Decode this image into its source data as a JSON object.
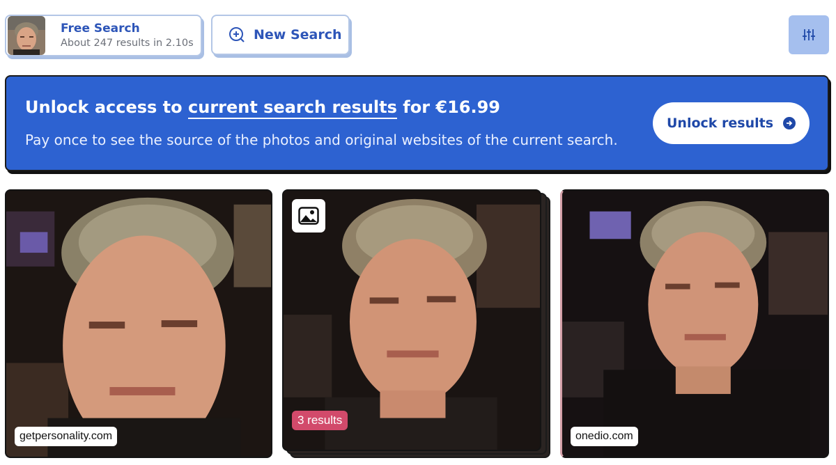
{
  "query": {
    "title": "Free Search",
    "subtitle": "About 247 results in 2.10s"
  },
  "toolbar": {
    "new_search_label": "New Search",
    "filter_icon": "sliders-icon"
  },
  "banner": {
    "title_prefix": "Unlock access to ",
    "title_link": "current search results",
    "title_suffix": " for €16.99",
    "subtitle": "Pay once to see the source of the photos and original websites of the current search.",
    "button_label": "Unlock results"
  },
  "results": [
    {
      "source": "getpersonality.com"
    },
    {
      "results_badge": "3 results",
      "badge_icon": "image-icon"
    },
    {
      "source": "onedio.com"
    }
  ],
  "colors": {
    "accent": "#2d62d1",
    "results_badge": "#d24a6b",
    "filter_button": "#a5bfee"
  }
}
